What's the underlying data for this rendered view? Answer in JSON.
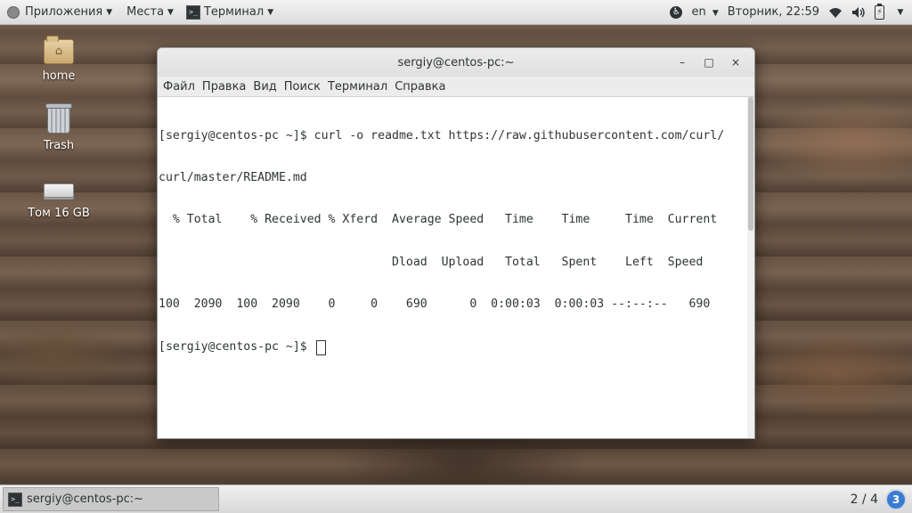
{
  "top_panel": {
    "applications_label": "Приложения",
    "places_label": "Места",
    "active_app_label": "Терминал",
    "language": "en",
    "datetime": "Вторник, 22:59"
  },
  "desktop": {
    "icons": [
      {
        "label": "home"
      },
      {
        "label": "Trash"
      },
      {
        "label": "Том 16 GB"
      }
    ]
  },
  "window": {
    "title": "sergiy@centos-pc:~",
    "buttons": {
      "minimize": "–",
      "maximize": "□",
      "close": "×"
    },
    "menu": [
      "Файл",
      "Правка",
      "Вид",
      "Поиск",
      "Терминал",
      "Справка"
    ],
    "terminal_lines": [
      "[sergiy@centos-pc ~]$ curl -o readme.txt https://raw.githubusercontent.com/curl/",
      "curl/master/README.md",
      "  % Total    % Received % Xferd  Average Speed   Time    Time     Time  Current",
      "                                 Dload  Upload   Total   Spent    Left  Speed",
      "100  2090  100  2090    0     0    690      0  0:00:03  0:00:03 --:--:--   690"
    ],
    "prompt": "[sergiy@centos-pc ~]$ "
  },
  "bottom_panel": {
    "task_label": "sergiy@centos-pc:~",
    "workspace": "2 / 4",
    "notifications": "3"
  }
}
